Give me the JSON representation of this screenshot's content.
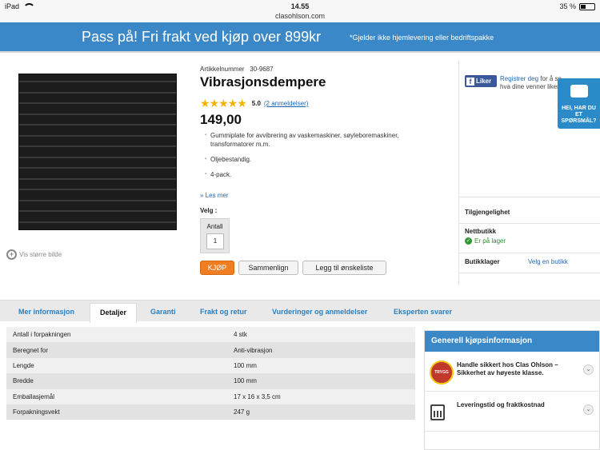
{
  "statusbar": {
    "device": "iPad",
    "time": "14.55",
    "url": "clasohlson.com",
    "battery_text": "35 %",
    "battery_level": 0.35
  },
  "banner": {
    "main": "Pass på! Fri frakt ved kjøp over 899kr",
    "sub": "*Gjelder ikke hjemlevering eller bedriftspakke"
  },
  "product": {
    "article_label": "Artikkelnummer",
    "article_number": "30-9687",
    "title": "Vibrasjonsdempere",
    "rating_value": "5.0",
    "rating_stars": 5,
    "reviews_link": "(2 anmeldelser)",
    "price": "149,00",
    "bullets": [
      "Gummiplate for avvibrering av vaskemaskiner, søyleboremaskiner, transformatorer m.m.",
      "Oljebestandig.",
      "4-pack."
    ],
    "read_more": "» Les mer",
    "choose_label": "Velg :",
    "quantity_label": "Antall",
    "quantity_value": "1",
    "zoom_label": "Vis større bilde",
    "buy_button": "KJØP",
    "compare_button": "Sammenlign",
    "wishlist_button": "Legg til ønskeliste"
  },
  "facebook": {
    "like_label": "Liker",
    "register_link": "Registrer deg",
    "register_rest": "for å se hva dine venner liker."
  },
  "help": {
    "label": "HEI, HAR DU ET SPØRSMÅL?"
  },
  "availability": {
    "title": "Tilgjengelighet",
    "online_label": "Nettbutikk",
    "online_status": "Er på lager",
    "store_label": "Butikklager",
    "store_link": "Velg en butikk",
    "status_color": "#2e8b2e"
  },
  "tabs": [
    {
      "label": "Mer informasjon"
    },
    {
      "label": "Detaljer"
    },
    {
      "label": "Garanti"
    },
    {
      "label": "Frakt og retur"
    },
    {
      "label": "Vurderinger og anmeldelser"
    },
    {
      "label": "Eksperten svarer"
    }
  ],
  "details": [
    {
      "label": "Antall i forpakningen",
      "value": "4 stk"
    },
    {
      "label": "Beregnet for",
      "value": "Anti-vibrasjon"
    },
    {
      "label": "Lengde",
      "value": "100 mm"
    },
    {
      "label": "Bredde",
      "value": "100 mm"
    },
    {
      "label": "Emballasjemål",
      "value": "17 x 16 x 3,5 cm"
    },
    {
      "label": "Forpakningsvekt",
      "value": "247  g"
    }
  ],
  "info_box": {
    "title": "Generell kjøpsinformasjon",
    "items": [
      {
        "text": "Handle sikkert hos Clas Ohlson – Sikkerhet av høyeste klasse.",
        "icon": "trygg-handel-badge-icon"
      },
      {
        "text": "Leveringstid og fraktkostnad",
        "icon": "calculator-icon"
      }
    ]
  },
  "colors": {
    "accent_blue": "#3b88c9",
    "buy_orange": "#ef7d22",
    "link_blue": "#1f66b1",
    "star_gold": "#f2b300"
  }
}
